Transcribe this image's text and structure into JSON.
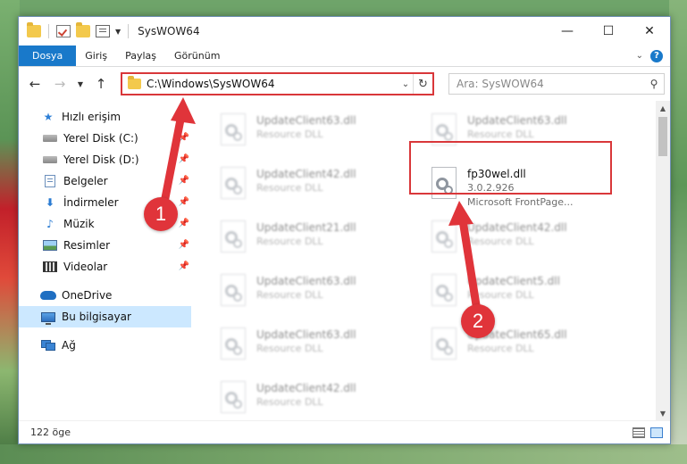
{
  "window": {
    "title": "SysWOW64",
    "caption": {
      "minimize": "—",
      "maximize": "☐",
      "close": "✕"
    }
  },
  "ribbon": {
    "tabs": [
      "Dosya",
      "Giriş",
      "Paylaş",
      "Görünüm"
    ],
    "expand": "⌄",
    "help": "?"
  },
  "address": {
    "path": "C:\\Windows\\SysWOW64",
    "search_placeholder": "Ara: SysWOW64"
  },
  "nav": {
    "quick_access": "Hızlı erişim",
    "items": [
      {
        "label": "Yerel Disk (C:)",
        "icon": "disk-icon"
      },
      {
        "label": "Yerel Disk (D:)",
        "icon": "disk-icon"
      },
      {
        "label": "Belgeler",
        "icon": "documents-icon"
      },
      {
        "label": "İndirmeler",
        "icon": "downloads-icon"
      },
      {
        "label": "Müzik",
        "icon": "music-icon"
      },
      {
        "label": "Resimler",
        "icon": "pictures-icon"
      },
      {
        "label": "Videolar",
        "icon": "videos-icon"
      }
    ],
    "onedrive": "OneDrive",
    "this_pc": "Bu bilgisayar",
    "network": "Ağ"
  },
  "files": {
    "left": [
      {
        "name": "UpdateClient63.dll",
        "type": "Resource DLL"
      },
      {
        "name": "UpdateClient42.dll",
        "type": "Resource DLL"
      },
      {
        "name": "UpdateClient21.dll",
        "type": "Resource DLL"
      },
      {
        "name": "UpdateClient63.dll",
        "type": "Resource DLL"
      },
      {
        "name": "UpdateClient63.dll",
        "type": "Resource DLL"
      },
      {
        "name": "UpdateClient42.dll",
        "type": "Resource DLL"
      }
    ],
    "right": [
      {
        "name": "UpdateClient63.dll",
        "type": "Resource DLL"
      },
      {
        "name": "UpdateClient42.dll",
        "type": "Resource DLL"
      },
      {
        "name": "UpdateClient5.dll",
        "type": "Resource DLL"
      },
      {
        "name": "UpdateClient65.dll",
        "type": "Resource DLL"
      }
    ],
    "highlighted": {
      "name": "fp30wel.dll",
      "version": "3.0.2.926",
      "description": "Microsoft FrontPage..."
    }
  },
  "annotations": {
    "step1": "1",
    "step2": "2"
  },
  "status": {
    "count": "122 öge"
  },
  "colors": {
    "accent": "#1979ca",
    "highlight": "#d9373a",
    "selected": "#cce8ff"
  }
}
